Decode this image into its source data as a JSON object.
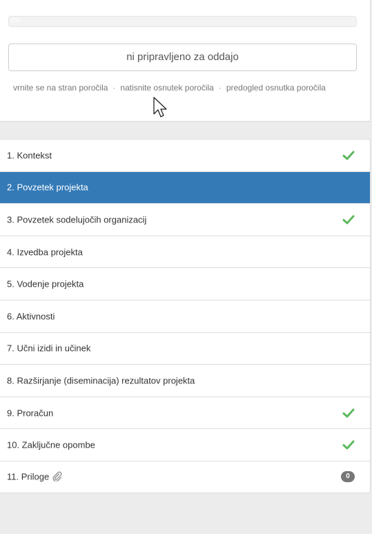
{
  "progress": {
    "value": 0,
    "text": "0%"
  },
  "submit": {
    "label": "ni pripravljeno za oddajo"
  },
  "links": {
    "back": "vrnite se na stran poročila",
    "print": "natisnite osnutek poročila",
    "preview": "predogled osnutka poročila",
    "separator": "·"
  },
  "sections": [
    {
      "label": "1. Kontekst",
      "status": "check-icon"
    },
    {
      "label": "2. Povzetek projekta",
      "active": true
    },
    {
      "label": "3. Povzetek sodelujočih organizacij",
      "status": "check-icon"
    },
    {
      "label": "4. Izvedba projekta"
    },
    {
      "label": "5. Vodenje projekta"
    },
    {
      "label": "6. Aktivnosti"
    },
    {
      "label": "7. Učni izidi in učinek"
    },
    {
      "label": "8. Razširjanje (diseminacija) rezultatov projekta"
    },
    {
      "label": "9. Proračun",
      "status": "check-icon"
    },
    {
      "label": "10. Zaključne opombe",
      "status": "check-icon"
    },
    {
      "label": "11. Priloge",
      "icon": "paperclip-icon",
      "badge": "0"
    }
  ],
  "colors": {
    "active_bg": "#337ab7",
    "check": "#5cb85c",
    "badge_bg": "#777777"
  }
}
